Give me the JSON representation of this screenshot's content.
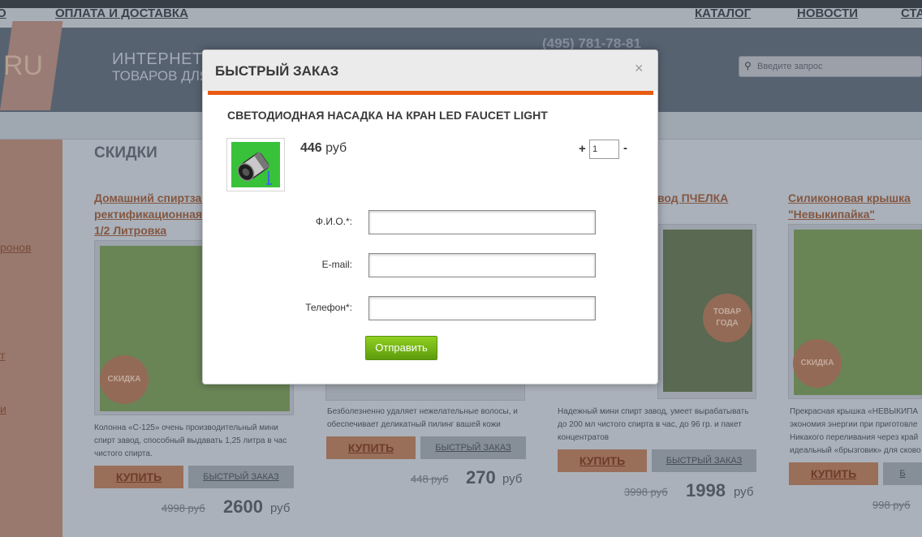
{
  "background": {
    "logo_text": "RU",
    "tagline_line1": "ИНТЕРНЕТ-",
    "tagline_line2": "ТОВАРОВ ДЛЯ",
    "phone": "(495) 781-78-81",
    "search_placeholder": "Введите запрос",
    "nav": [
      "О",
      "ОПЛАТА И ДОСТАВКА",
      "КАТАЛОГ",
      "НОВОСТИ",
      "СТА"
    ],
    "sidebar_items": [
      "ронов",
      "т",
      "и"
    ],
    "section_title": "СКИДКИ",
    "products": [
      {
        "title_lines": [
          "Домашний спиртзав",
          "ректификационная",
          "1/2 Литровка"
        ],
        "badge": "СКИДКА",
        "desc_lines": [
          "Колонна «С-125» очень производительный мини",
          "спирт завод, способный выдавать 1,25 литра в час",
          "чистого спирта."
        ],
        "buy": "КУПИТЬ",
        "quick": "БЫСТРЫЙ ЗАКАЗ",
        "old_price": "4998 руб",
        "new_price": "2600",
        "currency": "руб"
      },
      {
        "title_lines": [],
        "badge": "",
        "desc_lines": [
          "Безболезненно удаляет нежелательные волосы, и",
          "обеспечивает деликатный пилинг вашей кожи"
        ],
        "buy": "КУПИТЬ",
        "quick": "БЫСТРЫЙ ЗАКАЗ",
        "old_price": "448 руб",
        "new_price": "270",
        "currency": "руб"
      },
      {
        "title_lines": [
          "вод ПЧЕЛКА"
        ],
        "badge": "ТОВАР ГОДА",
        "desc_lines": [
          "Надежный мини спирт завод, умеет вырабатывать",
          "до 200 мл чистого спирта в час, до 96 гр. и пакет",
          "концентратов"
        ],
        "buy": "КУПИТЬ",
        "quick": "БЫСТРЫЙ ЗАКАЗ",
        "old_price": "3998 руб",
        "new_price": "1998",
        "currency": "руб"
      },
      {
        "title_lines": [
          "Силиконовая крышка",
          "\"Невыкипайка\""
        ],
        "badge": "СКИДКА",
        "desc_lines": [
          "Прекрасная крышка «НЕВЫКИПА",
          "экономия энергии при приготовле",
          "Никакого переливания через край",
          "идеальный «брызговик» для сково"
        ],
        "buy": "КУПИТЬ",
        "quick": "Б",
        "old_price": "998 руб",
        "new_price": "",
        "currency": ""
      }
    ]
  },
  "modal": {
    "title": "БЫСТРЫЙ ЗАКАЗ",
    "close": "×",
    "product_name": "СВЕТОДИОДНАЯ НАСАДКА НА КРАН LED FAUCET LIGHT",
    "price_value": "446",
    "price_currency": "руб",
    "qty_plus": "+",
    "qty_value": "1",
    "qty_minus": "-",
    "fields": [
      {
        "label": "Ф.И.О.*:",
        "value": ""
      },
      {
        "label": "E-mail:",
        "value": ""
      },
      {
        "label": "Телефон*:",
        "value": ""
      }
    ],
    "submit": "Отправить"
  },
  "colors": {
    "accent": "#e85b12",
    "submit_green": "#6fb316"
  }
}
